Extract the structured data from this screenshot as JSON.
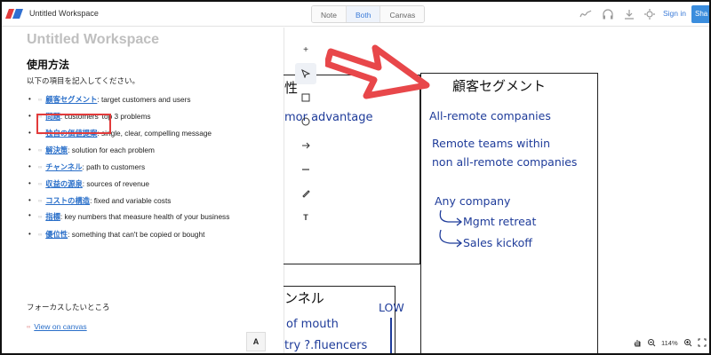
{
  "app": {
    "title": "Untitled Workspace"
  },
  "modes": [
    "Note",
    "Both",
    "Canvas"
  ],
  "active_mode": "Both",
  "header": {
    "signin_label": "Sign in",
    "share_label": "Sha"
  },
  "note": {
    "doc_title": "Untitled Workspace",
    "heading": "使用方法",
    "intro": "以下の項目を記入してください。",
    "items": [
      {
        "link": "顧客セグメント",
        "text": ": target customers and users"
      },
      {
        "link": "問題",
        "text": ": customers' top 3 problems"
      },
      {
        "link": "独自の価値提案",
        "text": ": single, clear, compelling message"
      },
      {
        "link": "解決策",
        "text": ": solution for each problem"
      },
      {
        "link": "チャンネル",
        "text": ": path to customers"
      },
      {
        "link": "収益の源泉",
        "text": ": sources of revenue"
      },
      {
        "link": "コストの構造",
        "text": ": fixed and variable costs"
      },
      {
        "link": "指標",
        "text": ": key numbers that measure health of your business"
      },
      {
        "link": "優位性",
        "text": ": something that can't be copied or bought"
      }
    ],
    "focus_label": "フォーカスしたいところ",
    "view_canvas": "View on canvas",
    "font_button": "A"
  },
  "canvas": {
    "left_box_title": "性",
    "left_box_text": "mor advantage",
    "customer_title": "顧客セグメント",
    "segments": [
      "All-remote companies",
      "Remote teams within",
      "non all-remote companies",
      "Any company",
      "Mgmt retreat",
      "Sales kickoff"
    ],
    "channel_title": "ンネル",
    "channel_lines": [
      "of mouth",
      "try ?.fluencers"
    ],
    "low_label": "LOW"
  },
  "zoom": {
    "level": "114%"
  },
  "colors": {
    "accent": "#3b7bd8",
    "highlight": "#e23b3b",
    "arrow": "#e8474a",
    "ink": "#1f3c9a"
  }
}
